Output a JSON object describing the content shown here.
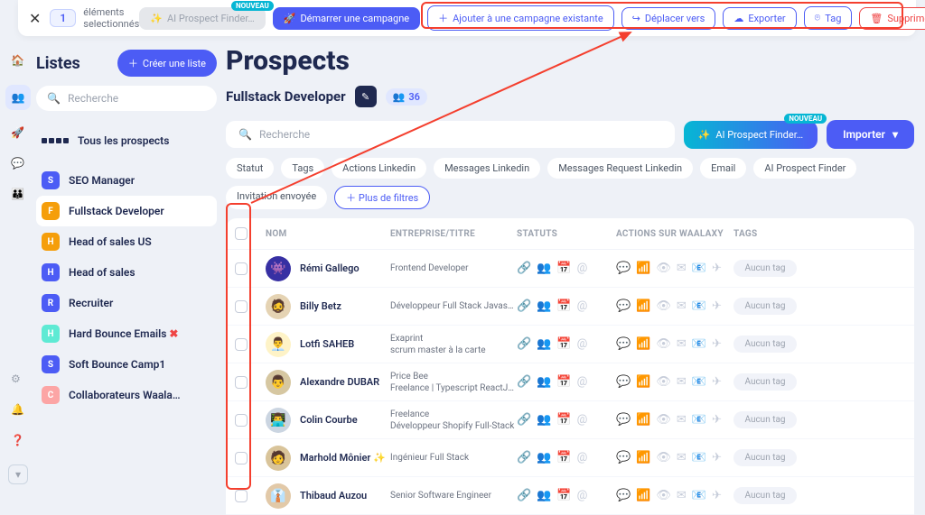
{
  "selection": {
    "count": "1",
    "label": "éléments selectionnés"
  },
  "topbar": {
    "ai_label": "AI Prospect Finder…",
    "new_badge": "NOUVEAU",
    "start_label": "Démarrer une campagne",
    "add_label": "Ajouter à une campagne existante",
    "move_label": "Déplacer vers",
    "export_label": "Exporter",
    "tag_label": "Tag",
    "delete_label": "Supprimer"
  },
  "sidebar": {
    "title": "Listes",
    "create_label": "Créer une liste",
    "search_placeholder": "Recherche",
    "all_label": "Tous les prospects",
    "lists": [
      {
        "letter": "S",
        "color": "#4c5cf5",
        "label": "SEO Manager"
      },
      {
        "letter": "F",
        "color": "#f59e0b",
        "label": "Fullstack Developer",
        "active": true
      },
      {
        "letter": "H",
        "color": "#f59e0b",
        "label": "Head of sales US"
      },
      {
        "letter": "H",
        "color": "#4c5cf5",
        "label": "Head of sales"
      },
      {
        "letter": "R",
        "color": "#4c5cf5",
        "label": "Recruiter"
      },
      {
        "letter": "H",
        "color": "#5eead4",
        "label": "Hard Bounce Emails",
        "suffix": "✖"
      },
      {
        "letter": "S",
        "color": "#4c5cf5",
        "label": "Soft Bounce Camp1"
      },
      {
        "letter": "C",
        "color": "#fca5a5",
        "label": "Collaborateurs Waala…"
      }
    ]
  },
  "main": {
    "title": "Prospects",
    "subtitle": "Fullstack Developer",
    "count": "36",
    "search_placeholder": "Recherche",
    "ai_label": "AI Prospect Finder…",
    "new_badge": "NOUVEAU",
    "import_label": "Importer",
    "filters": [
      "Statut",
      "Tags",
      "Actions Linkedin",
      "Messages Linkedin",
      "Messages Request Linkedin",
      "Email",
      "AI Prospect Finder",
      "Invitation envoyée"
    ],
    "more_filters": "Plus de filtres"
  },
  "table": {
    "headers": {
      "nom": "NOM",
      "entreprise": "ENTREPRISE/TITRE",
      "statuts": "STATUTS",
      "actions": "ACTIONS SUR WAALAXY",
      "tags": "TAGS"
    },
    "no_tag": "Aucun tag",
    "rows": [
      {
        "avatar_bg": "#3730a3",
        "emoji": "👾",
        "name": "Rémi Gallego",
        "line1": "Frontend Developer",
        "line2": ""
      },
      {
        "avatar_bg": "#e5d3b3",
        "emoji": "🧔",
        "name": "Billy Betz",
        "line1": "Développeur Full Stack Javas…",
        "line2": ""
      },
      {
        "avatar_bg": "#fef3c7",
        "emoji": "👨‍💼",
        "name": "Lotfi SAHEB",
        "line1": "Exaprint",
        "line2": "scrum master à la carte"
      },
      {
        "avatar_bg": "#d6c7a1",
        "emoji": "👨",
        "name": "Alexandre DUBAR",
        "line1": "Price Bee",
        "line2": "Freelance | Typescript ReactJ…"
      },
      {
        "avatar_bg": "#cbd5e1",
        "emoji": "👨‍💻",
        "name": "Colin Courbe",
        "line1": "Freelance",
        "line2": "Développeur Shopify Full-Stack"
      },
      {
        "avatar_bg": "#d9c49a",
        "emoji": "🧑",
        "name": "Marhold Mônier ✨",
        "line1": "Ingénieur Full Stack",
        "line2": ""
      },
      {
        "avatar_bg": "#e2c9a8",
        "emoji": "👔",
        "name": "Thibaud Auzou",
        "line1": "Senior Software Engineer",
        "line2": ""
      }
    ]
  }
}
